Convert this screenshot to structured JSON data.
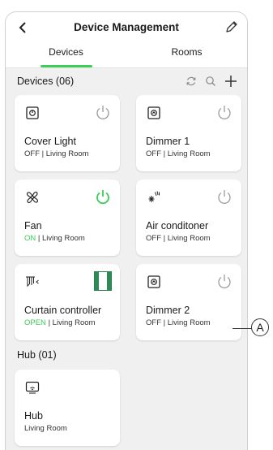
{
  "header": {
    "title": "Device Management"
  },
  "tabs": [
    {
      "label": "Devices",
      "active": true
    },
    {
      "label": "Rooms",
      "active": false
    }
  ],
  "devices_section": {
    "label": "Devices (06)"
  },
  "devices": [
    {
      "name": "Cover Light",
      "state": "OFF",
      "room": "| Living Room",
      "icon": "cover-light-icon",
      "power_on": false
    },
    {
      "name": "Dimmer 1",
      "state": "OFF",
      "room": "| Living Room",
      "icon": "dimmer-icon",
      "power_on": false
    },
    {
      "name": "Fan",
      "state": "ON",
      "room": "| Living Room",
      "icon": "fan-icon",
      "power_on": true
    },
    {
      "name": "Air conditoner",
      "state": "OFF",
      "room": "| Living Room",
      "icon": "air-conditioner-icon",
      "power_on": false
    },
    {
      "name": "Curtain controller",
      "state": "OPEN",
      "room": "| Living Room",
      "icon": "curtain-icon",
      "power_on": false
    },
    {
      "name": "Dimmer 2",
      "state": "OFF",
      "room": "| Living Room",
      "icon": "dimmer-icon",
      "power_on": false
    }
  ],
  "hub_section": {
    "label": "Hub (01)"
  },
  "hub": {
    "name": "Hub",
    "room": "Living Room",
    "icon": "hub-icon"
  },
  "callout": {
    "label": "A"
  },
  "colors": {
    "accent": "#3dcd58",
    "background": "#f0f0f0",
    "card": "#ffffff"
  }
}
